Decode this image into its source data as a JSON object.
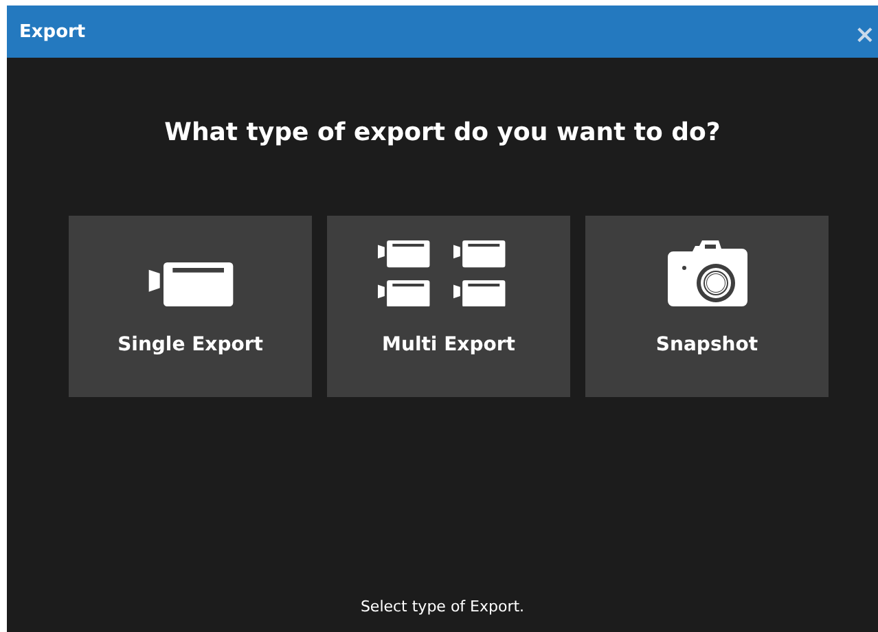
{
  "window": {
    "title": "Export",
    "close": "×"
  },
  "heading": "What type of export do you want to do?",
  "options": [
    {
      "kind": "single",
      "label": "Single Export"
    },
    {
      "kind": "multi",
      "label": "Multi Export"
    },
    {
      "kind": "snapshot",
      "label": "Snapshot"
    }
  ],
  "status": "Select type of Export."
}
